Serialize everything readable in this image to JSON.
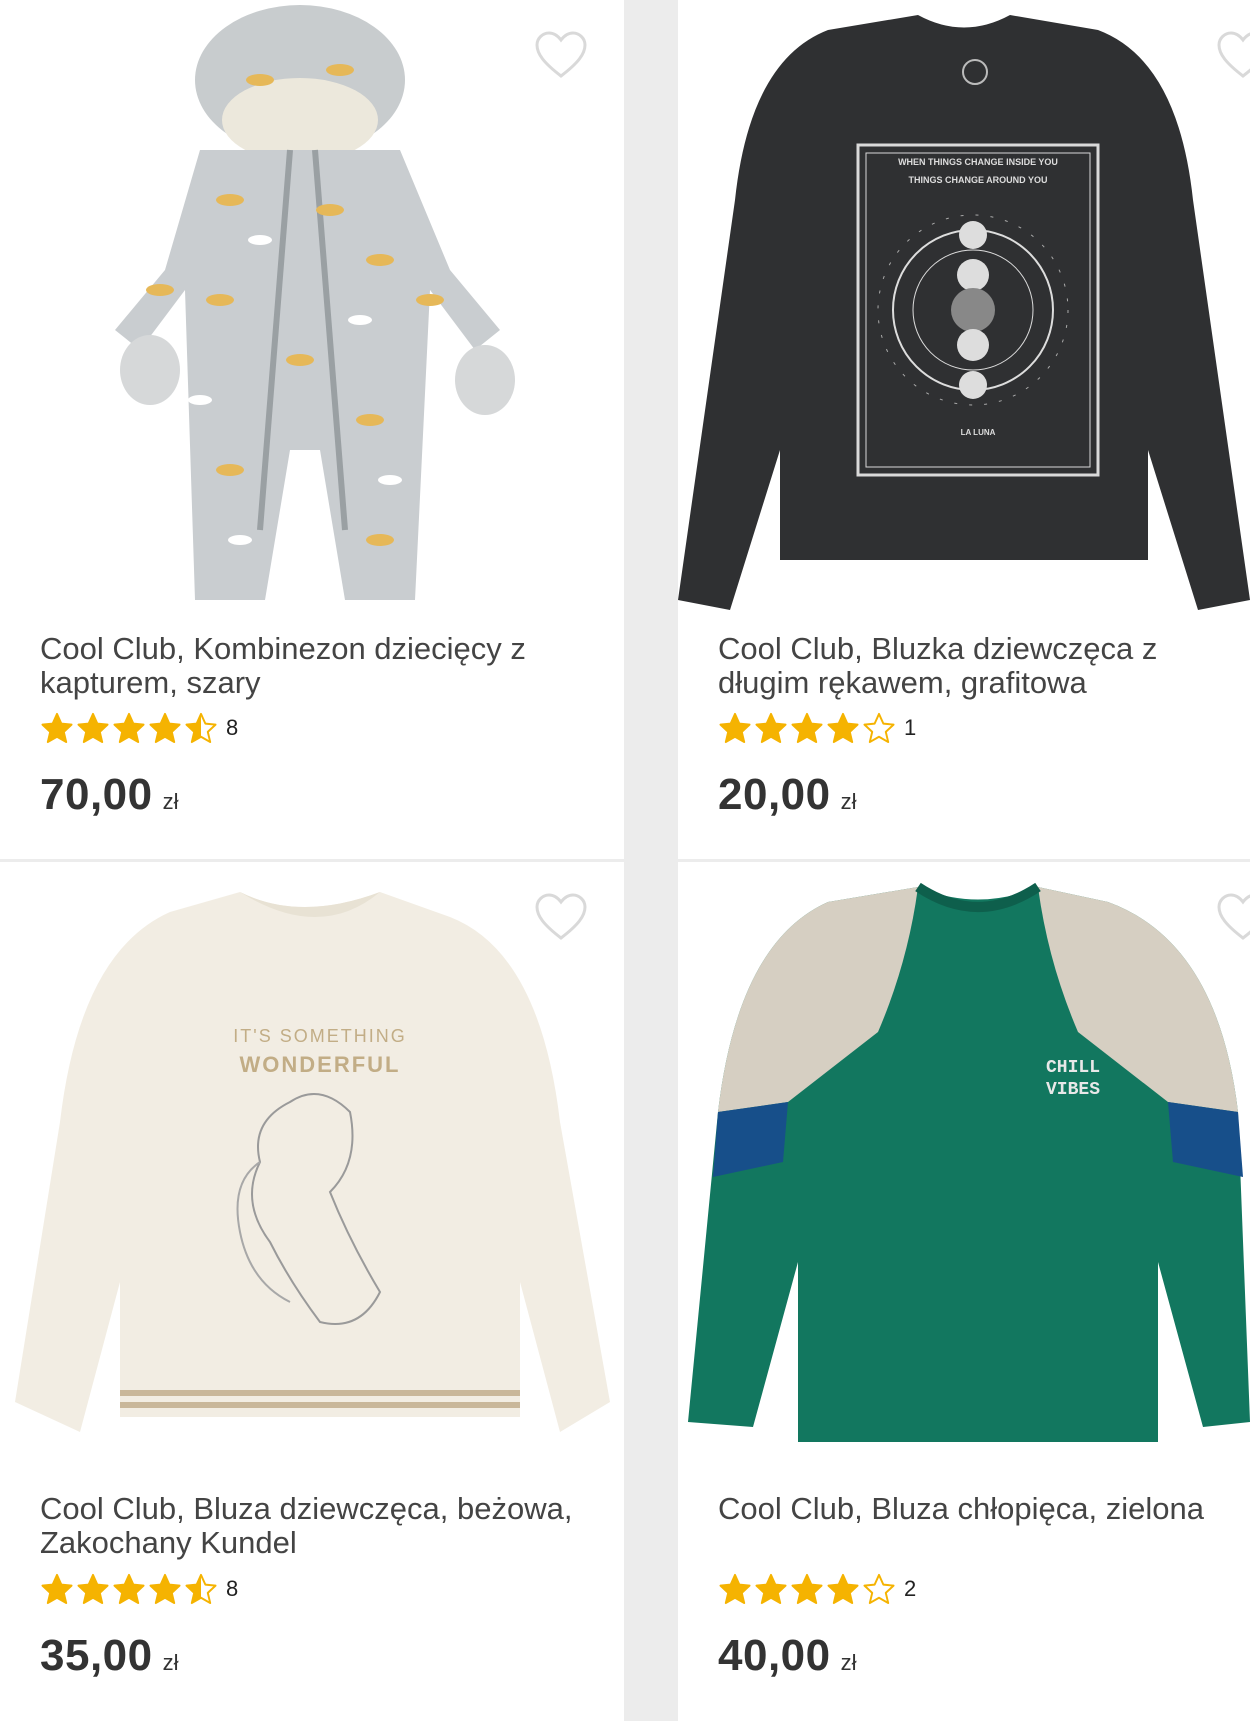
{
  "products": [
    {
      "title": "Cool Club, Kombinezon dziecięcy z kapturem, szary",
      "rating": 4.5,
      "reviews": "8",
      "price": "70,00",
      "currency": "zł",
      "image": "grey-snowsuit-image",
      "favorite_icon": "heart-outline-icon"
    },
    {
      "title": "Cool Club, Bluzka dziewczęca z długim rękawem, grafitowa",
      "rating": 4,
      "reviews": "1",
      "price": "20,00",
      "currency": "zł",
      "image": "graphite-longsleeve-image",
      "favorite_icon": "heart-outline-icon",
      "print_text": [
        "WHEN THINGS CHANGE INSIDE YOU",
        "THINGS CHANGE AROUND YOU",
        "LA LUNA"
      ]
    },
    {
      "title": "Cool Club, Bluza dziewczęca, beżowa, Zakochany Kundel",
      "rating": 4.5,
      "reviews": "8",
      "price": "35,00",
      "currency": "zł",
      "image": "beige-sweatshirt-image",
      "favorite_icon": "heart-outline-icon",
      "print_text": [
        "IT'S SOMETHING",
        "WONDERFUL"
      ]
    },
    {
      "title": "Cool Club, Bluza chłopięca, zielona",
      "rating": 4,
      "reviews": "2",
      "price": "40,00",
      "currency": "zł",
      "image": "green-sweatshirt-image",
      "favorite_icon": "heart-outline-icon",
      "print_text": [
        "CHILL",
        "VIBES"
      ]
    }
  ],
  "colors": {
    "star": "#f5b301",
    "heart_outline": "#d9d9d9",
    "page_bg": "#ececec",
    "card_bg": "#ffffff"
  }
}
